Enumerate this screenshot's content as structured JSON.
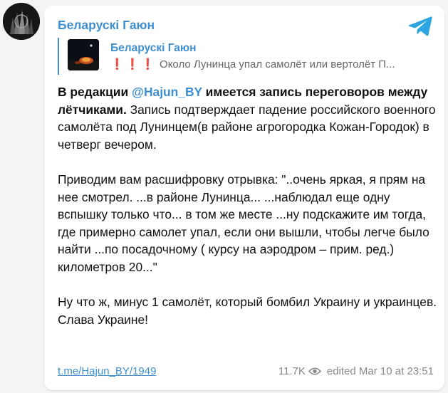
{
  "post": {
    "channel_name": "Беларускі Гаюн",
    "forwarded": {
      "channel_name": "Беларускі Гаюн",
      "emoji": "❗❗❗",
      "preview_text": "Около Лунинца упал самолёт или вертолёт П..."
    },
    "paragraph1": {
      "bold_prefix": "В редакции ",
      "mention": "@Hajun_BY",
      "bold_suffix": " имеется запись переговоров между лётчиками.",
      "rest": " Запись подтверждает падение российского военного самолёта под Лунинцем(в районе агрогородка Кожан-Городок) в четверг вечером."
    },
    "paragraph2": "Приводим вам расшифровку отрывка: \"..очень яркая, я прям на нее смотрел. ...в районе Лунинца... ...наблюдал еще одну вспышку только что... в том же месте ...ну подскажите им тогда, где примерно самолет упал, если они вышли, чтобы легче было найти ...по посадочному ( курсу на аэродром – прим. ред.) километров 20...\"",
    "paragraph3": "Ну что ж, минус 1 самолёт, который бомбил Украину и украинцев. Слава Украине!",
    "footer": {
      "link": "t.me/Hajun_BY/1949",
      "views": "11.7K",
      "edited_label": "edited",
      "date": "Mar 10 at 23:51"
    },
    "icons": {
      "channel": "telegram-logo-icon",
      "views": "eye-icon"
    },
    "colors": {
      "accent": "#3d8fd1",
      "telegram": "#2ca5e0",
      "alert": "#e02c2c"
    }
  }
}
